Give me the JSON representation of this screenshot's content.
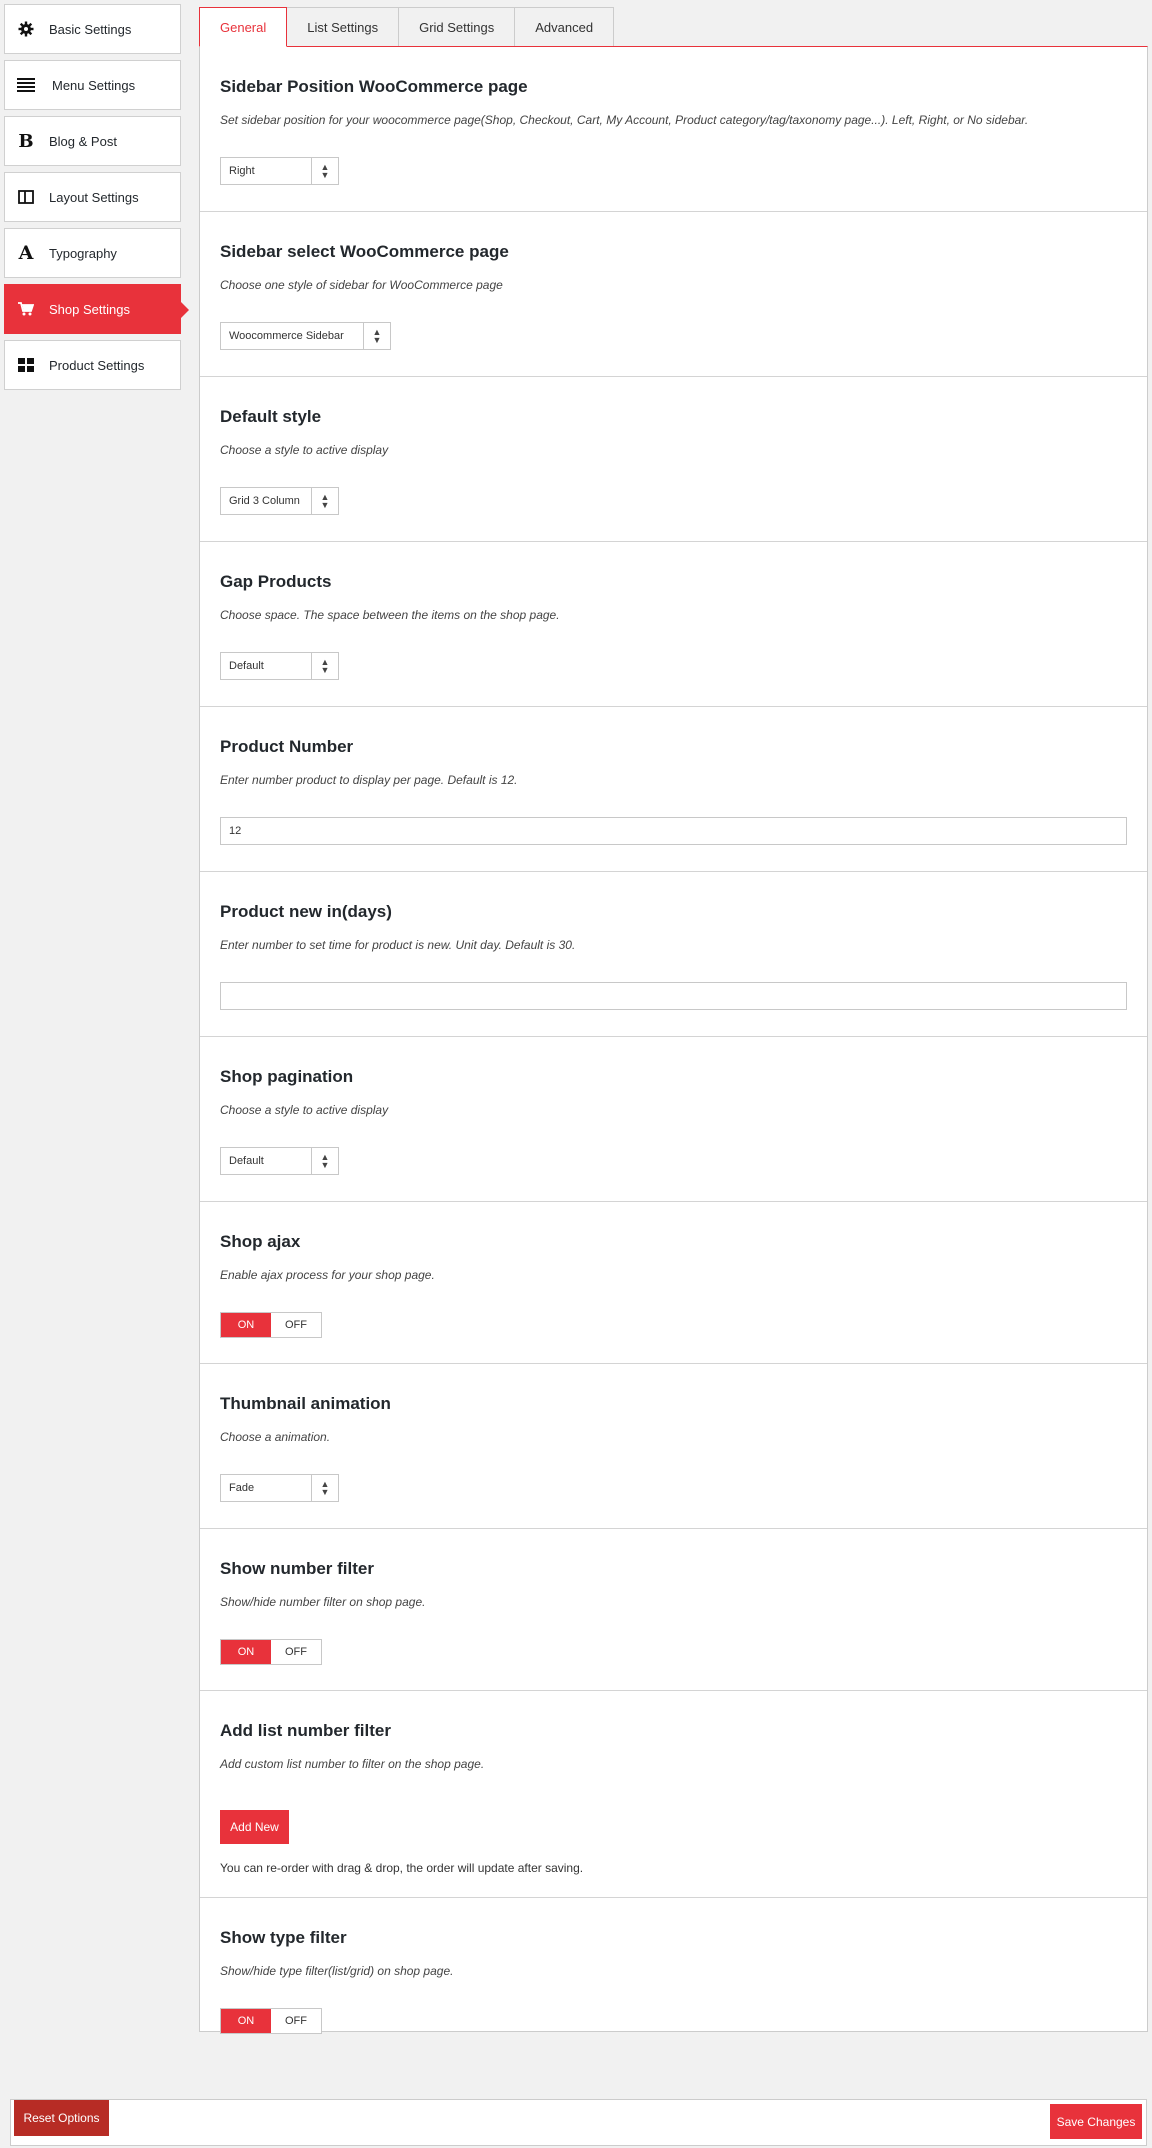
{
  "sidebar": {
    "items": [
      {
        "label": "Basic Settings",
        "icon": "gear-icon"
      },
      {
        "label": "Menu Settings",
        "icon": "bars-icon"
      },
      {
        "label": "Blog & Post",
        "icon": "bold-b-icon"
      },
      {
        "label": "Layout Settings",
        "icon": "columns-icon"
      },
      {
        "label": "Typography",
        "icon": "font-a-icon"
      },
      {
        "label": "Shop Settings",
        "icon": "cart-icon",
        "active": true
      },
      {
        "label": "Product Settings",
        "icon": "grid-icon"
      }
    ]
  },
  "tabs": [
    {
      "label": "General",
      "active": true
    },
    {
      "label": "List Settings"
    },
    {
      "label": "Grid Settings"
    },
    {
      "label": "Advanced"
    }
  ],
  "sections": {
    "sidebar_position": {
      "title": "Sidebar Position WooCommerce page",
      "desc": "Set sidebar position for your woocommerce page(Shop, Checkout, Cart, My Account, Product category/tag/taxonomy page...). Left, Right, or No sidebar.",
      "value": "Right"
    },
    "sidebar_select": {
      "title": "Sidebar select WooCommerce page",
      "desc": "Choose one style of sidebar for WooCommerce page",
      "value": "Woocommerce Sidebar"
    },
    "default_style": {
      "title": "Default style",
      "desc": "Choose a style to active display",
      "value": "Grid 3 Column"
    },
    "gap_products": {
      "title": "Gap Products",
      "desc": "Choose space. The space between the items on the shop page.",
      "value": "Default"
    },
    "product_number": {
      "title": "Product Number",
      "desc": "Enter number product to display per page. Default is 12.",
      "value": "12"
    },
    "product_new": {
      "title": "Product new in(days)",
      "desc": "Enter number to set time for product is new. Unit day. Default is 30.",
      "value": ""
    },
    "shop_pagination": {
      "title": "Shop pagination",
      "desc": "Choose a style to active display",
      "value": "Default"
    },
    "shop_ajax": {
      "title": "Shop ajax",
      "desc": "Enable ajax process for your shop page.",
      "on_label": "ON",
      "off_label": "OFF",
      "state": "ON"
    },
    "thumbnail_animation": {
      "title": "Thumbnail animation",
      "desc": "Choose a animation.",
      "value": "Fade"
    },
    "show_number_filter": {
      "title": "Show number filter",
      "desc": "Show/hide number filter on shop page.",
      "on_label": "ON",
      "off_label": "OFF",
      "state": "ON"
    },
    "add_list_number_filter": {
      "title": "Add list number filter",
      "desc": "Add custom list number to filter on the shop page.",
      "button": "Add New",
      "note": "You can re-order with drag & drop, the order will update after saving."
    },
    "show_type_filter": {
      "title": "Show type filter",
      "desc": "Show/hide type filter(list/grid) on shop page.",
      "on_label": "ON",
      "off_label": "OFF",
      "state": "ON"
    }
  },
  "footer": {
    "reset_label": "Reset Options",
    "save_label": "Save Changes"
  },
  "colors": {
    "accent": "#e8323b",
    "reset": "#b72c25",
    "background": "#f1f1f1"
  }
}
